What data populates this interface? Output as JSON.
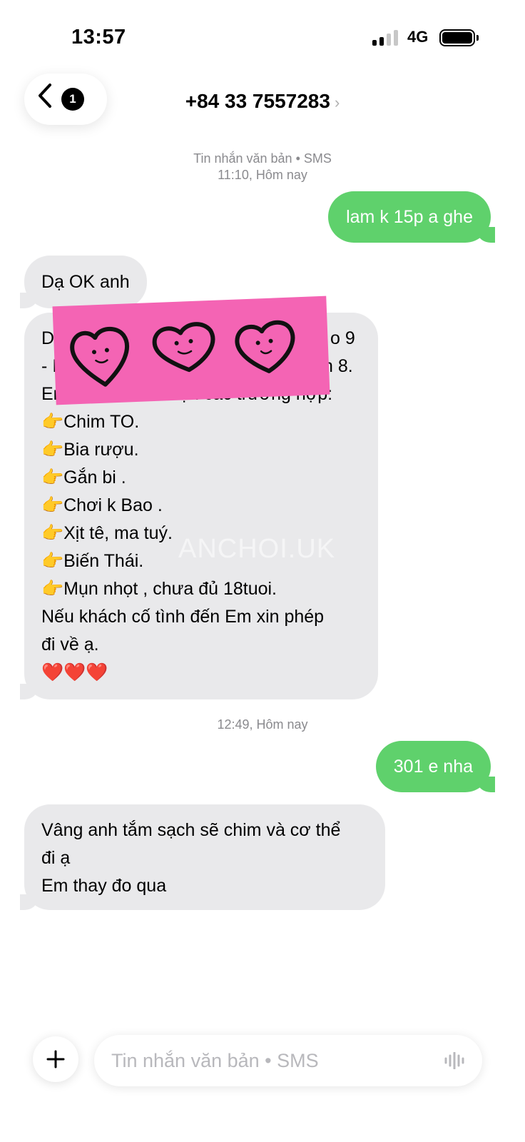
{
  "status_bar": {
    "time": "13:57",
    "network": "4G"
  },
  "header": {
    "back_count": "1",
    "contact": "+84 33 7557283",
    "contact_chevron": "›"
  },
  "conversation": {
    "meta1": {
      "line1": "Tin nhắn văn bản • SMS",
      "line2": "11:10, Hôm nay"
    },
    "msg1": "lam k 15p a ghe",
    "msg2": "Dạ OK anh",
    "msg3_lines": [
      "Da",
      "o 9",
      "- I",
      "n 8.",
      "Em tuyệt đối k nhận các trường hợp:",
      "👉Chim TO.",
      "👉Bia rượu.",
      "👉Gắn bi .",
      "👉Chơi k Bao .",
      "👉Xịt tê, ma tuý.",
      "👉Biến Thái.",
      "👉Mụn nhọt , chưa đủ 18tuoi.",
      "Nếu khách cố tình đến Em xin phép",
      "đi về ạ.",
      "❤️❤️❤️"
    ],
    "watermark": "ANCHOI.UK",
    "meta2": "12:49, Hôm nay",
    "msg4": "301 e nha",
    "msg5_lines": [
      "Vâng anh tắm sạch sẽ chim và cơ thể",
      "đi ạ",
      "Em thay đo qua"
    ]
  },
  "input": {
    "placeholder": "Tin nhắn văn bản • SMS"
  },
  "colors": {
    "outgoing": "#5fd16c",
    "incoming": "#e9e9eb",
    "sticker": "#f464b4"
  }
}
